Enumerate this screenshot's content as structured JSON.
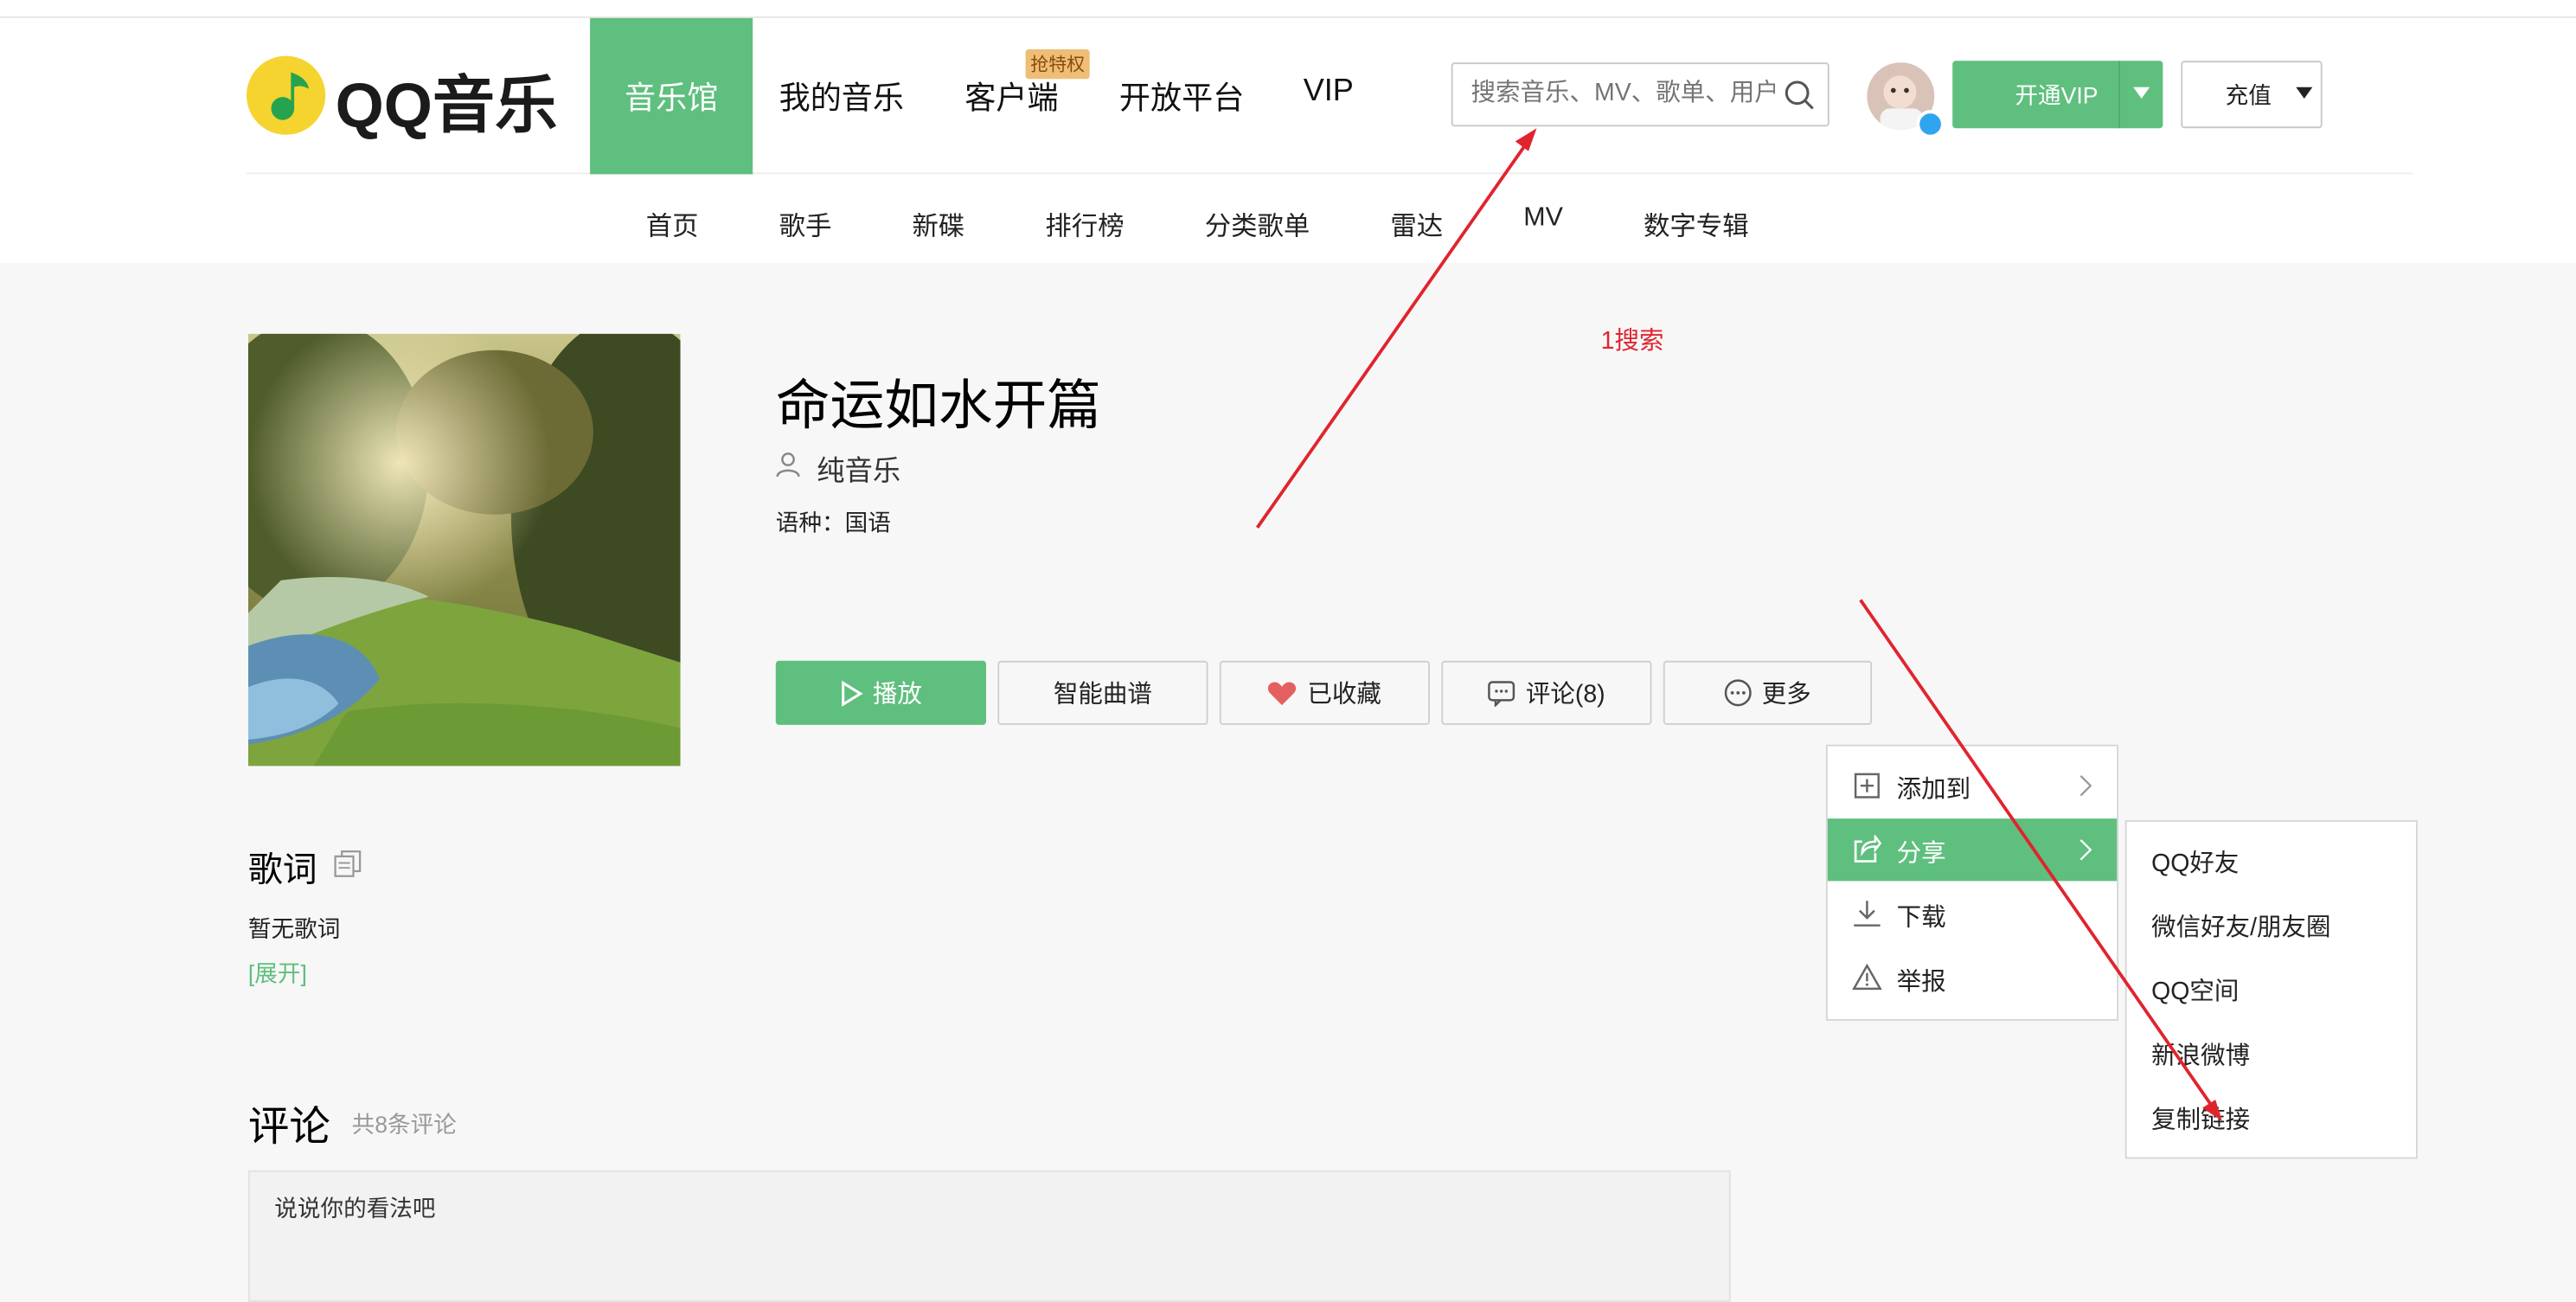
{
  "header": {
    "logo_text": "QQ音乐",
    "nav": [
      {
        "label": "音乐馆",
        "active": true
      },
      {
        "label": "我的音乐"
      },
      {
        "label": "客户端",
        "badge": "抢特权"
      },
      {
        "label": "开放平台"
      },
      {
        "label": "VIP"
      }
    ],
    "search": {
      "placeholder": "搜索音乐、MV、歌单、用户"
    },
    "vip_button": "开通VIP",
    "recharge_button": "充值"
  },
  "subnav": [
    "首页",
    "歌手",
    "新碟",
    "排行榜",
    "分类歌单",
    "雷达",
    "MV",
    "数字专辑"
  ],
  "song": {
    "title": "命运如水开篇",
    "singer": "纯音乐",
    "language": "语种：国语"
  },
  "actions": {
    "play": "播放",
    "score": "智能曲谱",
    "favorite": "已收藏",
    "comment": "评论(8)",
    "more": "更多"
  },
  "more_menu": {
    "items": [
      {
        "label": "添加到",
        "icon": "plus-box-icon"
      },
      {
        "label": "分享",
        "icon": "share-icon",
        "highlighted": true
      },
      {
        "label": "下载",
        "icon": "download-icon"
      },
      {
        "label": "举报",
        "icon": "warning-icon"
      }
    ]
  },
  "share_menu": {
    "items": [
      "QQ好友",
      "微信好友/朋友圈",
      "QQ空间",
      "新浪微博",
      "复制链接"
    ]
  },
  "annotation": {
    "text": "1搜索",
    "color": "#e0242e"
  },
  "lyrics": {
    "heading": "歌词",
    "empty": "暂无歌词",
    "expand": "[展开]"
  },
  "comments": {
    "heading": "评论",
    "count": "共8条评论",
    "placeholder": "说说你的看法吧"
  },
  "colors": {
    "accent": "#5fbf7e",
    "annotation": "#e0242e",
    "badge": "#eebe76"
  }
}
